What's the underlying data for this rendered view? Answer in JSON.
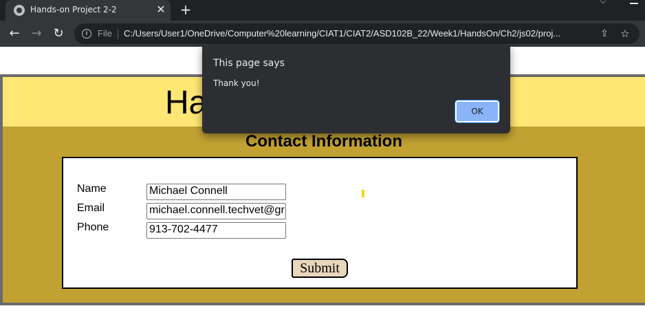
{
  "browser": {
    "tab_title": "Hands-on Project 2-2",
    "tab_close": "✕",
    "new_tab": "+",
    "back": "←",
    "forward": "→",
    "reload": "↻",
    "file_label": "File",
    "url": "C:/Users/User1/OneDrive/Computer%20learning/CIAT1/CIAT2/ASD102B_22/Week1/HandsOn/Ch2/js02/proj...",
    "icons": [
      "globe-icon",
      "info-icon",
      "share-icon",
      "star-icon"
    ]
  },
  "page": {
    "heading_visible": "Ha",
    "section_title": "Contact Information",
    "fields": [
      {
        "label": "Name",
        "value": "Michael Connell"
      },
      {
        "label": "Email",
        "value": "michael.connell.techvet@gr"
      },
      {
        "label": "Phone",
        "value": "913-702-4477"
      }
    ],
    "submit_label": "Submit"
  },
  "dialog": {
    "title": "This page says",
    "message": "Thank you!",
    "ok_label": "OK"
  },
  "colors": {
    "header_band": "#ffe675",
    "body_band": "#c1a131",
    "submit_bg": "#e8d7bd",
    "ok_button": "#8ab4f8"
  }
}
